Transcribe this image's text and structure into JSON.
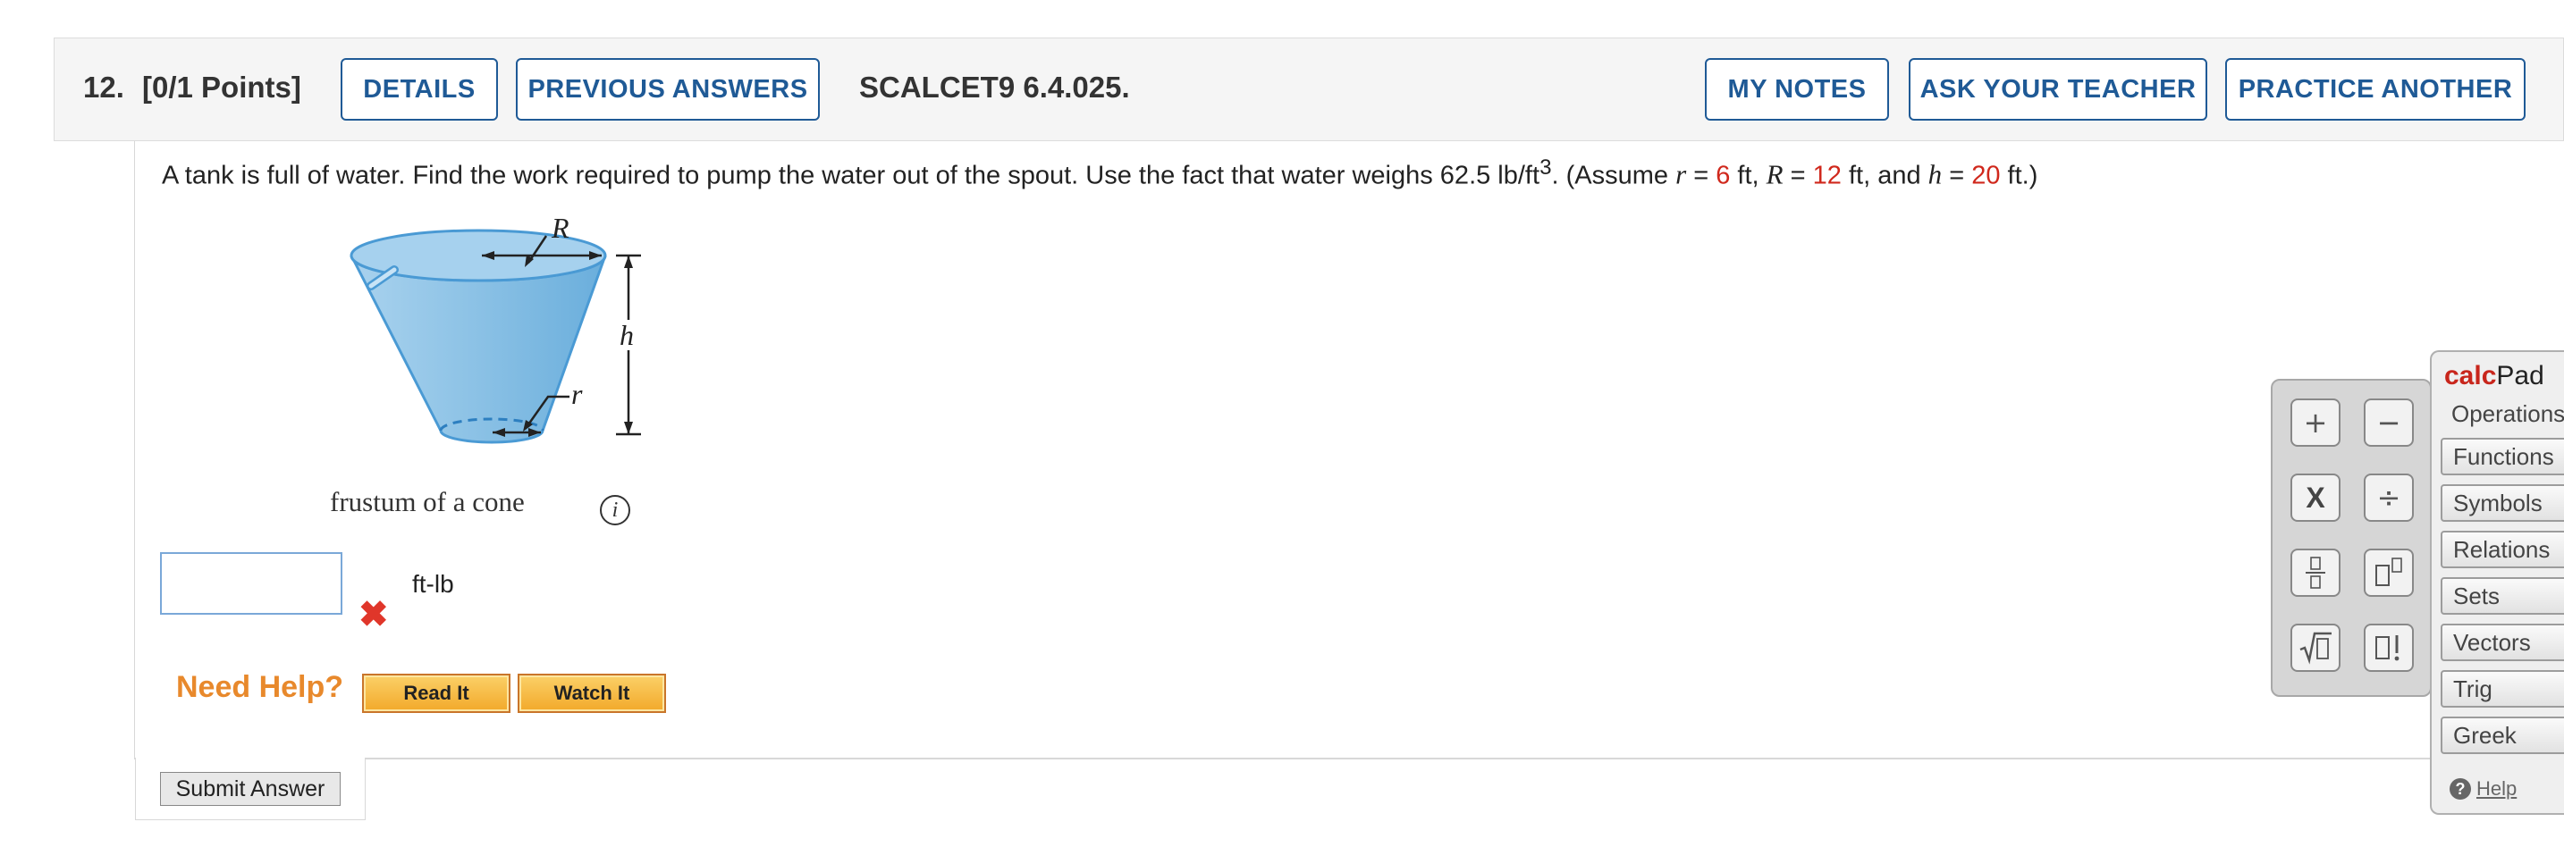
{
  "header": {
    "number": "12.",
    "points": "[0/1 Points]",
    "details_label": "DETAILS",
    "previous_answers_label": "PREVIOUS ANSWERS",
    "code": "SCALCET9 6.4.025.",
    "my_notes_label": "MY NOTES",
    "ask_teacher_label": "ASK YOUR TEACHER",
    "practice_another_label": "PRACTICE ANOTHER"
  },
  "question": {
    "text_part1": "A tank is full of water. Find the work required to pump the water out of the spout. Use the fact that water weighs 62.5 lb/ft",
    "superscript": "3",
    "text_part2": ". (Assume ",
    "r_var": "r",
    "eq1": " = ",
    "r_val": "6",
    "ft1": " ft, ",
    "R_var": "R",
    "eq2": " = ",
    "R_val": "12",
    "ft2": " ft, and ",
    "h_var": "h",
    "eq3": " = ",
    "h_val": "20",
    "ft3": " ft.)"
  },
  "figure": {
    "label_R": "R",
    "label_h": "h",
    "label_r": "r",
    "caption": "frustum of a cone",
    "info_icon": "i",
    "tank_color": "#8ec3e6"
  },
  "answer": {
    "value": "",
    "unit": "ft-lb",
    "status_icon": "✖",
    "status": "incorrect"
  },
  "help": {
    "label": "Need Help?",
    "read_it": "Read It",
    "watch_it": "Watch It"
  },
  "submit_label": "Submit Answer",
  "calcpad": {
    "title_calc": "calc",
    "title_pad": "Pad",
    "operations_label": "Operations",
    "keys": [
      "+",
      "−",
      "X",
      "÷",
      "▯/▯",
      "▯▯",
      "√▯",
      "▯!"
    ],
    "tabs": [
      "Functions",
      "Symbols",
      "Relations",
      "Sets",
      "Vectors",
      "Trig",
      "Greek"
    ],
    "help_label": "Help"
  },
  "colors": {
    "link_blue": "#1f5a96",
    "highlight_red": "#d0281c",
    "need_help_orange": "#e8892c"
  }
}
